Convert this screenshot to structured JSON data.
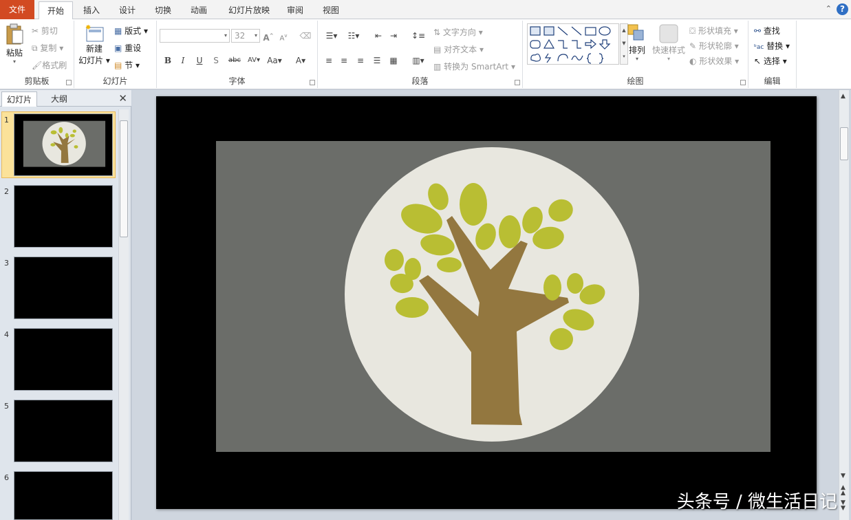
{
  "tabs": {
    "file": "文件",
    "home": "开始",
    "insert": "插入",
    "design": "设计",
    "transitions": "切换",
    "animations": "动画",
    "slideshow": "幻灯片放映",
    "review": "审阅",
    "view": "视图"
  },
  "clipboard": {
    "paste": "粘贴",
    "cut": "剪切",
    "copy": "复制",
    "format_painter": "格式刷",
    "label": "剪贴板"
  },
  "slides_group": {
    "new_slide_line1": "新建",
    "new_slide_line2": "幻灯片",
    "layout": "版式",
    "reset": "重设",
    "section": "节",
    "label": "幻灯片"
  },
  "font": {
    "name_value": "",
    "size_value": "32",
    "bold": "B",
    "italic": "I",
    "underline": "U",
    "shadow": "S",
    "strike": "abc",
    "spacing": "AV",
    "case": "Aa",
    "color": "A",
    "label": "字体"
  },
  "paragraph": {
    "text_direction": "文字方向",
    "align_text": "对齐文本",
    "smartart": "转换为 SmartArt",
    "label": "段落"
  },
  "drawing": {
    "arrange": "排列",
    "quick_styles": "快速样式",
    "fill": "形状填充",
    "outline": "形状轮廓",
    "effects": "形状效果",
    "label": "绘图"
  },
  "editing": {
    "find": "查找",
    "replace": "替换",
    "select": "选择",
    "label": "编辑"
  },
  "left_pane": {
    "tab_slides": "幻灯片",
    "tab_outline": "大纲",
    "close": "✕",
    "slide_numbers": [
      "1",
      "2",
      "3",
      "4",
      "5",
      "6"
    ]
  },
  "watermark": "头条号 / 微生活日记",
  "colors": {
    "file_tab": "#d24a22",
    "panel_gray": "#6b6d69",
    "circle": "#e8e7df",
    "trunk": "#93773f",
    "leaf": "#b9be33"
  }
}
